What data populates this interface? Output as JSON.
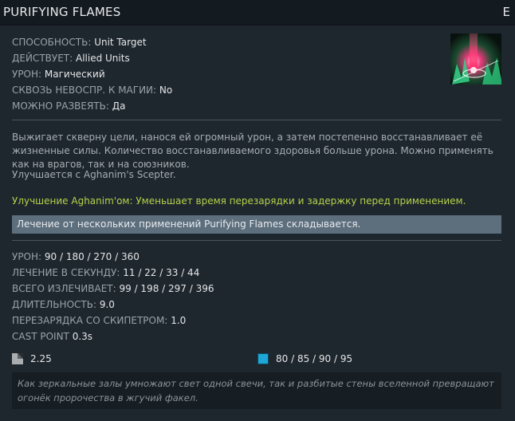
{
  "header": {
    "title": "PURIFYING FLAMES",
    "hotkey": "E"
  },
  "icon": {
    "name": "purifying-flames-icon"
  },
  "properties": [
    {
      "label": "СПОСОБНОСТЬ:",
      "value": "Unit Target"
    },
    {
      "label": "ДЕЙСТВУЕТ:",
      "value": "Allied Units"
    },
    {
      "label": "УРОН:",
      "value": "Магический"
    },
    {
      "label": "СКВОЗЬ НЕВОСПР. К МАГИИ:",
      "value": "No"
    },
    {
      "label": "МОЖНО РАЗВЕЯТЬ:",
      "value": "Да"
    }
  ],
  "description": "Выжигает скверну цели, нанося ей огромный урон, а затем постепенно восстанавливает её жизненные силы. Количество восстанавливаемого здоровья больше урона. Можно применять как на врагов, так и на союзников.",
  "upgrade_note": "Улучшается с Aghanim's Scepter.",
  "aghanim_upgrade": "Улучшение Aghanim'ом: Уменьшает время перезарядки и задержку перед применением.",
  "note_box": "Лечение от нескольких применений Purifying Flames складывается.",
  "stats": [
    {
      "label": "УРОН:",
      "value": "90 / 180 / 270 / 360"
    },
    {
      "label": "ЛЕЧЕНИЕ В СЕКУНДУ:",
      "value": "11 / 22 / 33 / 44"
    },
    {
      "label": "ВСЕГО ИЗЛЕЧИВАЕТ:",
      "value": "99 / 198 / 297 / 396"
    },
    {
      "label": "ДЛИТЕЛЬНОСТЬ:",
      "value": "9.0"
    },
    {
      "label": "ПЕРЕЗАРЯДКА СО СКИПЕТРОМ:",
      "value": "1.0"
    },
    {
      "label": "CAST POINT",
      "value": "0.3s"
    }
  ],
  "cooldown": {
    "icon": "cooldown-icon",
    "value": "2.25"
  },
  "mana": {
    "icon": "mana-cost-icon",
    "value": "80 / 85 / 90 / 95",
    "color": "#1ea7d6"
  },
  "lore": "Как зеркальные залы умножают свет одной свечи, так и разбитые стены вселенной превращают огонёк пророчества в жгучий факел."
}
